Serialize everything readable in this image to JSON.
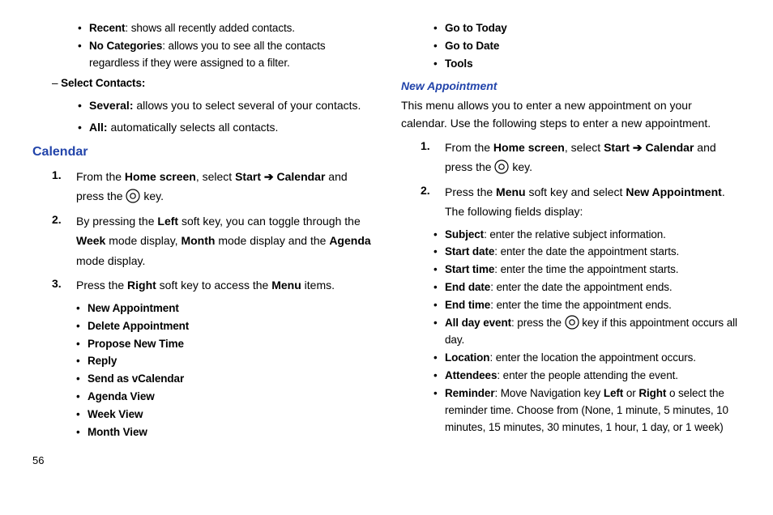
{
  "page_number": "56",
  "col1": {
    "pre_bullets": [
      {
        "term": "Recent",
        "desc": ": shows all recently added contacts."
      },
      {
        "term": "No Categories",
        "desc": ": allows you to see all the contacts regardless if they were assigned to a filter."
      }
    ],
    "dash_heading_prefix": "– ",
    "dash_heading": "Select Contacts:",
    "dash_bullets": [
      {
        "term": "Several:",
        "desc": " allows you to select several of your contacts."
      },
      {
        "term": "All:",
        "desc": " automatically selects all contacts."
      }
    ],
    "section_heading": "Calendar",
    "ol1": {
      "num": "1.",
      "pre": "From the ",
      "b1": "Home screen",
      "mid": ", select ",
      "b2": "Start ➔ Calendar",
      "after": " and press the ",
      "tail": " key."
    },
    "ol2": {
      "num": "2.",
      "pre": "By pressing the ",
      "b1": "Left",
      "mid1": " soft key, you can toggle through the ",
      "b2": "Week",
      "mid2": " mode display, ",
      "b3": "Month",
      "mid3": " mode display and the ",
      "b4": "Agenda",
      "tail": " mode display."
    },
    "ol3": {
      "num": "3.",
      "pre": "Press the ",
      "b1": "Right",
      "mid": " soft key to access the ",
      "b2": "Menu",
      "tail": " items."
    },
    "menu_bullets": [
      "New Appointment",
      "Delete Appointment",
      "Propose New Time",
      "Reply",
      "Send as vCalendar",
      "Agenda View",
      "Week View",
      "Month View"
    ]
  },
  "col2": {
    "top_bullets": [
      "Go to Today",
      "Go to Date",
      "Tools"
    ],
    "sub_heading": "New Appointment",
    "intro": "This menu allows you to enter a new appointment on your calendar. Use the following steps to enter a new appointment.",
    "ol1": {
      "num": "1.",
      "pre": "From the ",
      "b1": "Home screen",
      "mid": ", select ",
      "b2": "Start ➔ Calendar",
      "after": " and press the ",
      "tail": " key."
    },
    "ol2": {
      "num": "2.",
      "pre": "Press the ",
      "b1": "Menu",
      "mid": " soft key and select ",
      "b2": "New Appointment",
      "tail": ". The following fields display:"
    },
    "field_bullets_simple": [
      {
        "term": "Subject",
        "desc": ": enter the relative subject information."
      },
      {
        "term": "Start date",
        "desc": ": enter the date the appointment starts."
      },
      {
        "term": "Start time",
        "desc": ": enter the time the appointment starts."
      },
      {
        "term": "End date",
        "desc": ": enter the date the appointment ends."
      },
      {
        "term": "End time",
        "desc": ": enter the time the appointment ends."
      }
    ],
    "allday": {
      "term": "All day event",
      "pre": ": press the ",
      "tail": " key if this appointment occurs all day."
    },
    "field_bullets_tail": [
      {
        "term": "Location",
        "desc": ": enter the location the appointment occurs."
      },
      {
        "term": "Attendees",
        "desc": ": enter the people attending the event."
      }
    ],
    "reminder": {
      "term": "Reminder",
      "pre": ": Move Navigation key ",
      "b1": "Left",
      "mid": " or ",
      "b2": "Right",
      "tail": " o select the reminder time. Choose from (None, 1 minute, 5 minutes, 10 minutes, 15 minutes, 30 minutes, 1 hour, 1 day, or 1 week)"
    }
  }
}
